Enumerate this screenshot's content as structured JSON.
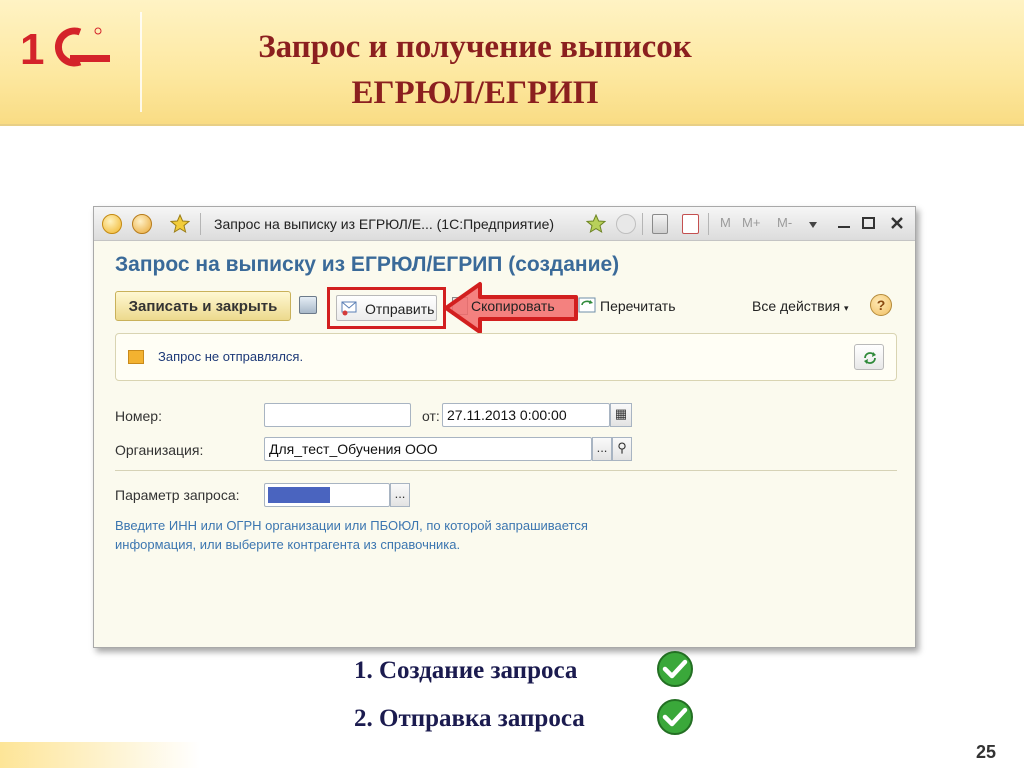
{
  "slide": {
    "title_line1": "Запрос и получение выписок",
    "title_line2": "ЕГРЮЛ/ЕГРИП",
    "page_number": "25"
  },
  "window": {
    "title": "Запрос на выписку из ЕГРЮЛ/Е... (1С:Предприятие)",
    "right_controls": [
      "M",
      "M+",
      "M-"
    ],
    "form_title": "Запрос на выписку из ЕГРЮЛ/ЕГРИП (создание)"
  },
  "toolbar": {
    "save_close": "Записать и закрыть",
    "send": "Отправить",
    "copy": "Скопировать",
    "reread": "Перечитать",
    "all_actions": "Все действия",
    "help": "?"
  },
  "status": {
    "text": "Запрос не отправлялся."
  },
  "form": {
    "number_label": "Номер:",
    "number_value": "",
    "date_label": "от:",
    "date_value": "27.11.2013  0:00:00",
    "org_label": "Организация:",
    "org_value": "Для_тест_Обучения ООО",
    "param_label": "Параметр запроса:",
    "hint": "Введите ИНН или ОГРН организации или ПБОЮЛ, по которой запрашивается информация, или выберите контрагента из справочника."
  },
  "notes": {
    "item1": "1. Создание запроса",
    "item2": "2. Отправка запроса"
  },
  "colors": {
    "title": "#8b1f1f",
    "form_title": "#3a6a99",
    "highlight": "#d21f1f",
    "hint": "#3c76b0"
  }
}
